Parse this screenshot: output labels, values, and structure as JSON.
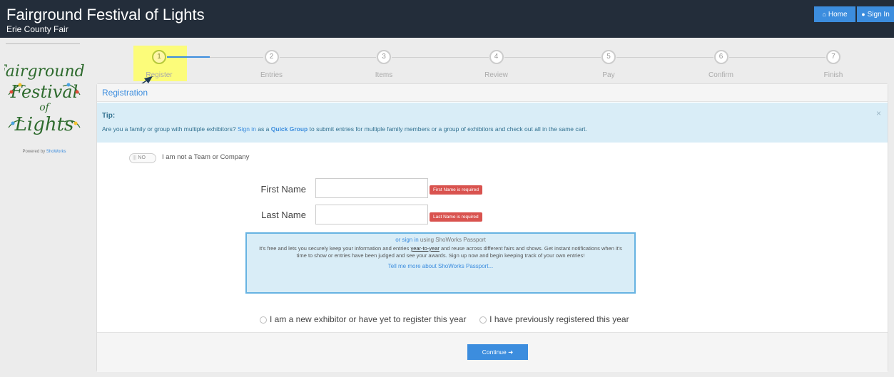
{
  "header": {
    "title": "Fairground Festival of Lights",
    "subtitle": "Erie County Fair",
    "home_label": "Home",
    "signin_label": "Sign In"
  },
  "sidebar": {
    "powered_prefix": "Powered by",
    "powered_brand": "ShoWorks"
  },
  "stepper": {
    "steps": [
      {
        "num": "1",
        "label": "Register"
      },
      {
        "num": "2",
        "label": "Entries"
      },
      {
        "num": "3",
        "label": "Items"
      },
      {
        "num": "4",
        "label": "Review"
      },
      {
        "num": "5",
        "label": "Pay"
      },
      {
        "num": "6",
        "label": "Confirm"
      },
      {
        "num": "7",
        "label": "Finish"
      }
    ],
    "active_index": 0
  },
  "panel": {
    "heading": "Registration",
    "tip": {
      "title": "Tip:",
      "text_before": "Are you a family or group with multiple exhibitors?",
      "signin_link": "Sign in",
      "text_as": "as a",
      "quick_group": "Quick Group",
      "text_after": "to submit entries for multiple family members or a group of exhibitors and check out all in the same cart.",
      "close": "×"
    },
    "toggle": {
      "state": "NO",
      "label": "I am not a Team or Company"
    },
    "fields": {
      "first_name_label": "First Name",
      "first_name_error": "First Name is required",
      "last_name_label": "Last Name",
      "last_name_error": "Last Name is required"
    },
    "passport": {
      "or": "or",
      "signin": "sign in",
      "using": "using ShoWorks Passport",
      "body_before": "It's free and lets you securely keep your information and entries",
      "body_ul": "year-to-year",
      "body_after": "and reuse across different fairs and shows. Get instant notifications when it's time to show or entries have been judged and see your awards. Sign up now and begin keeping track of your own entries!",
      "more": "Tell me more about ShoWorks Passport..."
    },
    "radios": {
      "new_exhibitor": "I am a new exhibitor or have yet to register this year",
      "previous": "I have previously registered this year"
    },
    "continue_label": "Continue"
  },
  "colors": {
    "header_bg": "#232d3a",
    "accent": "#3c8dde",
    "tip_bg": "#d9edf7",
    "error": "#d9534f",
    "highlight": "#ffff66"
  }
}
